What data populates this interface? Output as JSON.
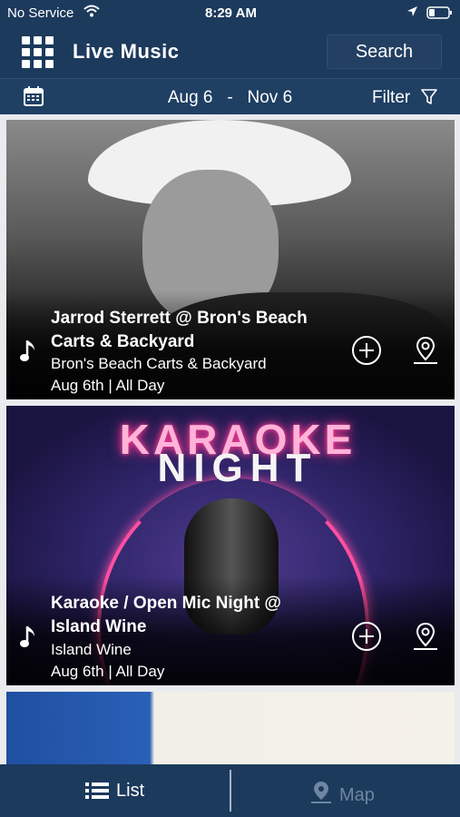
{
  "status_bar": {
    "carrier": "No Service",
    "time": "8:29 AM"
  },
  "header": {
    "title": "Live Music",
    "search_label": "Search"
  },
  "date_bar": {
    "from": "Aug 6",
    "separator": "-",
    "to": "Nov 6",
    "filter_label": "Filter"
  },
  "events": [
    {
      "title_line1": "Jarrod Sterrett @ Bron's Beach",
      "title_line2": "Carts & Backyard",
      "venue": "Bron's Beach Carts & Backyard",
      "date": "Aug 6th | All Day"
    },
    {
      "title_line1": "Karaoke / Open Mic Night @",
      "title_line2": "Island Wine",
      "venue": "Island Wine",
      "date": "Aug 6th | All Day",
      "image_text_1": "KARAOKE",
      "image_text_2": "NIGHT"
    }
  ],
  "tabbar": {
    "list_label": "List",
    "map_label": "Map"
  },
  "icons": [
    "grid-icon",
    "calendar-icon",
    "filter-icon",
    "music-note-icon",
    "add-circle-icon",
    "map-pin-icon",
    "list-icon",
    "wifi-icon",
    "battery-icon",
    "location-arrow-icon"
  ]
}
